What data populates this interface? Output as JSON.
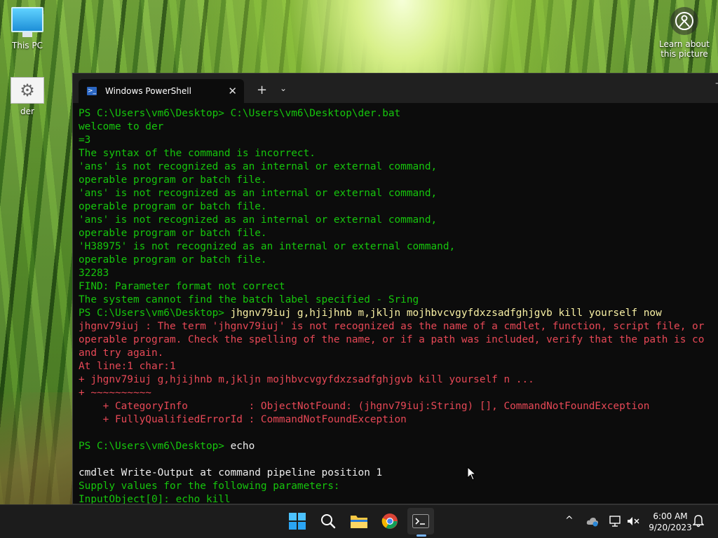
{
  "desktop": {
    "icons": [
      {
        "label": "This PC",
        "icon": "monitor-icon"
      },
      {
        "label": "der",
        "icon": "batch-file-gear-icon"
      }
    ],
    "learn_line1": "Learn about",
    "learn_line2": "this picture"
  },
  "window": {
    "tab_title": "Windows PowerShell",
    "tab_close": "✕",
    "new_tab": "+",
    "dropdown": "⌄",
    "minimize": "—"
  },
  "console": {
    "lines": [
      {
        "prompt": "PS C:\\Users\\vm6\\Desktop> ",
        "cmd": "C:\\Users\\vm6\\Desktop\\der.bat",
        "cmd_color": "green"
      },
      {
        "text": "welcome to der",
        "color": "green"
      },
      {
        "text": "=3",
        "color": "green"
      },
      {
        "text": "The syntax of the command is incorrect.",
        "color": "green"
      },
      {
        "text": "'ans' is not recognized as an internal or external command,",
        "color": "green"
      },
      {
        "text": "operable program or batch file.",
        "color": "green"
      },
      {
        "text": "'ans' is not recognized as an internal or external command,",
        "color": "green"
      },
      {
        "text": "operable program or batch file.",
        "color": "green"
      },
      {
        "text": "'ans' is not recognized as an internal or external command,",
        "color": "green"
      },
      {
        "text": "operable program or batch file.",
        "color": "green"
      },
      {
        "text": "'H38975' is not recognized as an internal or external command,",
        "color": "green"
      },
      {
        "text": "operable program or batch file.",
        "color": "green"
      },
      {
        "text": "32283",
        "color": "green"
      },
      {
        "text": "FIND: Parameter format not correct",
        "color": "green"
      },
      {
        "text": "The system cannot find the batch label specified - Sring",
        "color": "green"
      },
      {
        "prompt": "PS C:\\Users\\vm6\\Desktop> ",
        "cmd": "jhgnv79iuj g,hjijhnb m,jkljn mojhbvcvgyfdxzsadfghjgvb kill yourself now",
        "cmd_color": "yellow"
      },
      {
        "text": "jhgnv79iuj : The term 'jhgnv79iuj' is not recognized as the name of a cmdlet, function, script file, or",
        "color": "red"
      },
      {
        "text": "operable program. Check the spelling of the name, or if a path was included, verify that the path is co",
        "color": "red"
      },
      {
        "text": "and try again.",
        "color": "red"
      },
      {
        "text": "At line:1 char:1",
        "color": "red"
      },
      {
        "text": "+ jhgnv79iuj g,hjijhnb m,jkljn mojhbvcvgyfdxzsadfghjgvb kill yourself n ...",
        "color": "red"
      },
      {
        "text": "+ ~~~~~~~~~~",
        "color": "red"
      },
      {
        "text": "    + CategoryInfo          : ObjectNotFound: (jhgnv79iuj:String) [], CommandNotFoundException",
        "color": "red"
      },
      {
        "text": "    + FullyQualifiedErrorId : CommandNotFoundException",
        "color": "red"
      },
      {
        "text": "",
        "color": "green"
      },
      {
        "prompt": "PS C:\\Users\\vm6\\Desktop> ",
        "cmd": "echo",
        "cmd_color": "white"
      },
      {
        "text": "",
        "color": "green"
      },
      {
        "text": "cmdlet Write-Output at command pipeline position 1",
        "color": "white"
      },
      {
        "text": "Supply values for the following parameters:",
        "color": "green"
      },
      {
        "text": "InputObject[0]: echo kill",
        "color": "green"
      }
    ]
  },
  "taskbar": {
    "apps": [
      {
        "name": "start",
        "icon": "windows-logo-icon"
      },
      {
        "name": "search",
        "icon": "search-icon"
      },
      {
        "name": "file-explorer",
        "icon": "folder-icon"
      },
      {
        "name": "chrome",
        "icon": "chrome-icon"
      },
      {
        "name": "terminal",
        "icon": "terminal-icon"
      }
    ],
    "tray_chevron": "^",
    "time": "6:00 AM",
    "date": "9/20/2023"
  },
  "colors": {
    "console_bg": "#0c0c0c",
    "green": "#16c60c",
    "red": "#e74856",
    "yellow": "#f9f1a5",
    "white": "#ededed",
    "taskbar_bg": "#1c1c1c"
  }
}
